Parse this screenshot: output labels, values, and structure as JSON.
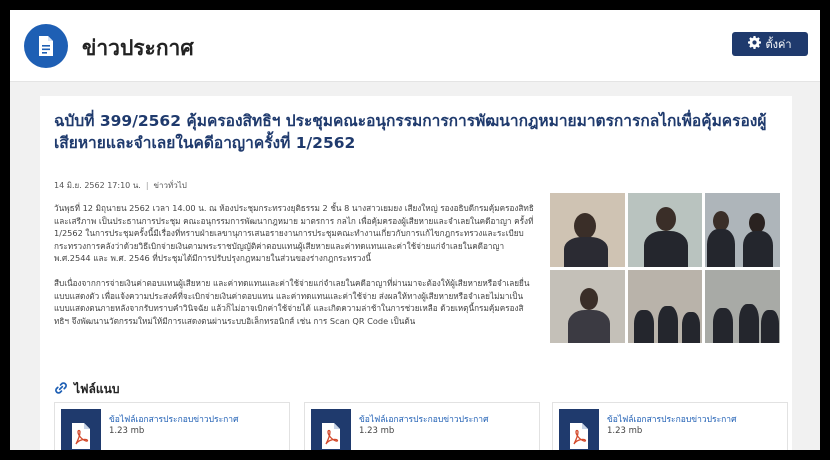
{
  "header": {
    "title": "ข่าวประกาศ",
    "settings_label": "ตั้งค่า"
  },
  "article": {
    "title": "ฉบับที่ 399/2562 คุ้มครองสิทธิฯ ประชุมคณะอนุกรรมการการพัฒนากฎหมายมาตรการกลไกเพื่อคุ้มครองผู้เสียหายและจำเลยในคดีอาญาครั้งที่ 1/2562",
    "date": "14 มิ.ย. 2562 17:10 น.",
    "category": "ข่าวทั่วไป",
    "paragraphs": [
      "วันพุธที่ 12 มิถุนายน 2562 เวลา 14.00 น. ณ ห้องประชุมกระทรวงยุติธรรม 2 ชั้น 8 นางสาวเยมยง เสียงใหญ่ รองอธิบดีกรมคุ้มครองสิทธิและเสรีภาพ เป็นประธานการประชุม คณะอนุกรรมการพัฒนากฎหมาย มาตรการ กลไก เพื่อคุ้มครองผู้เสียหายและจำเลยในคดีอาญา ครั้งที่ 1/2562 ในการประชุมครั้งนี้มีเรื่องที่ทราบฝ่ายเลขานุการเสนอรายงานการประชุมคณะทำงานเกี่ยวกับการแก้ไขกฎกระทรวงและระเบียบกระทรวงการคลังว่าด้วยวิธีเบิกจ่ายเงินตามพระราชบัญญัติค่าตอบแทนผู้เสียหายและค่าทดแทนและค่าใช้จ่ายแก่จำเลยในคดีอาญา พ.ศ.2544 และ พ.ศ. 2546 ที่ประชุมได้มีการปรับปรุงกฎหมายในส่วนของร่างกฎกระทรวงนี้",
      "สืบเนื่องจากการจ่ายเงินค่าตอบแทนผู้เสียหาย และค่าทดแทนและค่าใช้จ่ายแก่จำเลยในคดีอาญาที่ผ่านมาจะต้องให้ผู้เสียหายหรือจำเลยยื่นแบบแสดงตัว เพื่อแจ้งความประสงค์ที่จะเบิกจ่ายเงินค่าตอบแทน และค่าทดแทนและค่าใช้จ่าย ส่งผลให้ทางผู้เสียหายหรือจำเลยไม่มาเป็นแบบแสดงตนภายหลังจากรับทราบคำวินิจฉัย แล้วก็ไม่อาจเบิกค่าใช้จ่ายได้ และเกิดความล่าช้าในการช่วยเหลือ ด้วยเหตุนี้กรมคุ้มครองสิทธิฯ จึงพัฒนานวัตกรรมใหม่ให้มีการแสดงตนผ่านระบบอิเล็กทรอนิกส์ เช่น การ Scan QR Code เป็นต้น"
    ]
  },
  "attachments": {
    "title": "ไฟล์แนบ",
    "files": [
      {
        "name": "ข้อไฟล์เอกสารประกอบข่าวประกาศ",
        "size": "1.23 mb"
      },
      {
        "name": "ข้อไฟล์เอกสารประกอบข่าวประกาศ",
        "size": "1.23 mb"
      },
      {
        "name": "ข้อไฟล์เอกสารประกอบข่าวประกาศ",
        "size": "1.23 mb"
      }
    ]
  },
  "icons": {
    "header": "document-icon",
    "settings": "gear-icon",
    "attach": "link-icon",
    "file": "pdf-icon"
  },
  "colors": {
    "brand": "#1e5fb4",
    "navy": "#1f3a6d"
  }
}
